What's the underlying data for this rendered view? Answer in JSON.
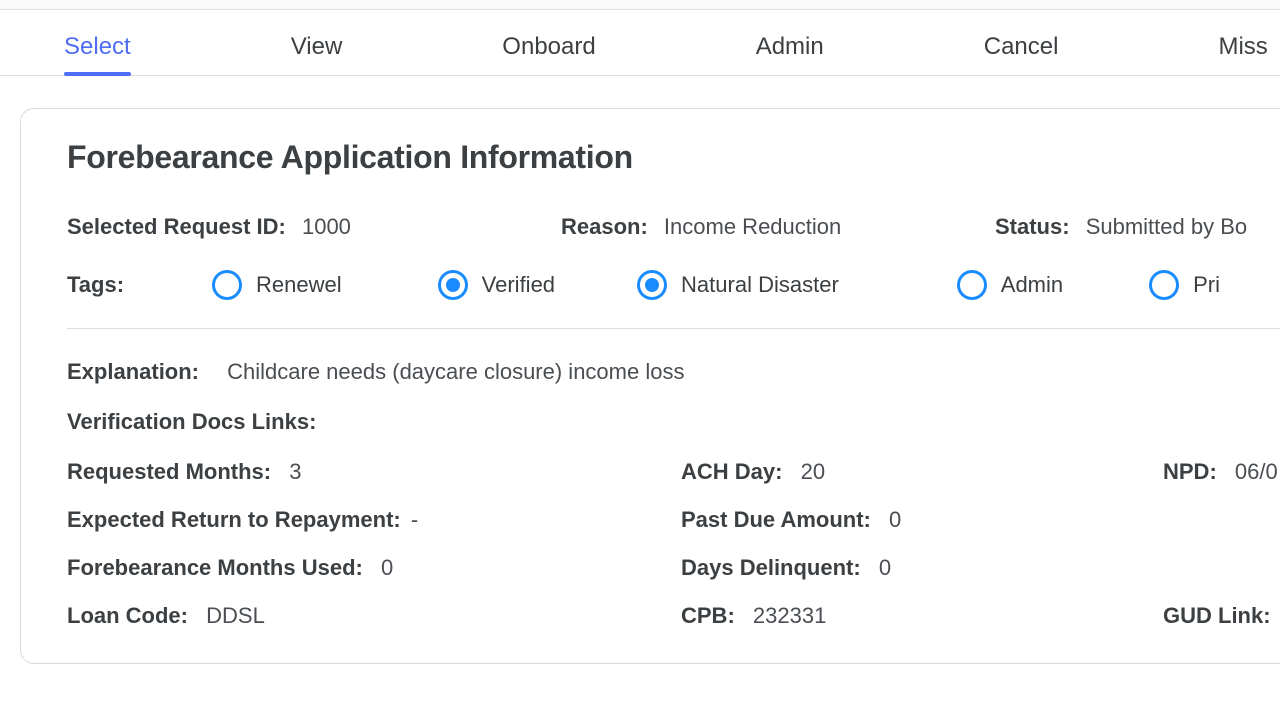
{
  "tabs": {
    "items": [
      "Select",
      "View",
      "Onboard",
      "Admin",
      "Cancel",
      "Miss"
    ],
    "active_index": 0
  },
  "panel": {
    "title": "Forebearance Application Information",
    "request_id": {
      "label": "Selected Request ID:",
      "value": "1000"
    },
    "reason": {
      "label": "Reason:",
      "value": "Income Reduction"
    },
    "status": {
      "label": "Status:",
      "value": "Submitted by Bo"
    },
    "tags_label": "Tags:",
    "tags": [
      {
        "label": "Renewel",
        "checked": false
      },
      {
        "label": "Verified",
        "checked": true
      },
      {
        "label": "Natural Disaster",
        "checked": true
      },
      {
        "label": "Admin",
        "checked": false
      },
      {
        "label": "Pri",
        "checked": false
      }
    ],
    "explanation": {
      "label": "Explanation:",
      "value": "Childcare needs (daycare closure) income loss"
    },
    "verif_docs": {
      "label": "Verification Docs Links:"
    },
    "requested_months": {
      "label": "Requested Months:",
      "value": "3"
    },
    "ach_day": {
      "label": "ACH Day:",
      "value": "20"
    },
    "npd": {
      "label": "NPD:",
      "value": "06/0"
    },
    "expected_return": {
      "label": "Expected Return to Repayment:",
      "value": "-"
    },
    "past_due": {
      "label": "Past Due Amount:",
      "value": "0"
    },
    "months_used": {
      "label": "Forebearance Months Used:",
      "value": "0"
    },
    "days_delinquent": {
      "label": "Days Delinquent:",
      "value": "0"
    },
    "loan_code": {
      "label": "Loan Code:",
      "value": "DDSL"
    },
    "cpb": {
      "label": "CPB:",
      "value": "232331"
    },
    "gud_link": {
      "label": "GUD Link:"
    }
  }
}
